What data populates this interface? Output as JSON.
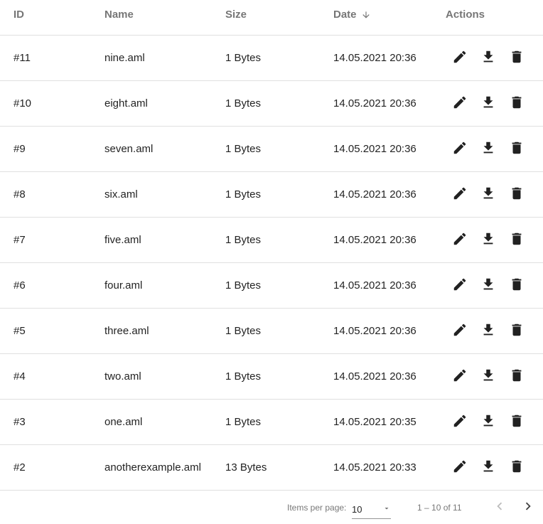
{
  "table": {
    "headers": {
      "id": "ID",
      "name": "Name",
      "size": "Size",
      "date": "Date",
      "actions": "Actions"
    },
    "sort": {
      "column": "Date",
      "direction": "descending",
      "icon": "arrow-down-icon"
    },
    "action_icons": [
      "edit-icon",
      "download-icon",
      "delete-icon"
    ],
    "rows": [
      {
        "id": "#11",
        "name": "nine.aml",
        "size": "1 Bytes",
        "date": "14.05.2021 20:36"
      },
      {
        "id": "#10",
        "name": "eight.aml",
        "size": "1 Bytes",
        "date": "14.05.2021 20:36"
      },
      {
        "id": "#9",
        "name": "seven.aml",
        "size": "1 Bytes",
        "date": "14.05.2021 20:36"
      },
      {
        "id": "#8",
        "name": "six.aml",
        "size": "1 Bytes",
        "date": "14.05.2021 20:36"
      },
      {
        "id": "#7",
        "name": "five.aml",
        "size": "1 Bytes",
        "date": "14.05.2021 20:36"
      },
      {
        "id": "#6",
        "name": "four.aml",
        "size": "1 Bytes",
        "date": "14.05.2021 20:36"
      },
      {
        "id": "#5",
        "name": "three.aml",
        "size": "1 Bytes",
        "date": "14.05.2021 20:36"
      },
      {
        "id": "#4",
        "name": "two.aml",
        "size": "1 Bytes",
        "date": "14.05.2021 20:36"
      },
      {
        "id": "#3",
        "name": "one.aml",
        "size": "1 Bytes",
        "date": "14.05.2021 20:35"
      },
      {
        "id": "#2",
        "name": "anotherexample.aml",
        "size": "13 Bytes",
        "date": "14.05.2021 20:33"
      }
    ]
  },
  "paginator": {
    "items_per_page_label": "Items per page:",
    "items_per_page_value": "10",
    "range_label": "1 – 10 of 11",
    "prev_icon": "chevron-left-icon",
    "next_icon": "chevron-right-icon",
    "prev_disabled": true
  },
  "colors": {
    "header_text": "#757575",
    "border": "#e0e0e0",
    "icon": "#212121",
    "disabled_icon": "#bdbdbd"
  }
}
